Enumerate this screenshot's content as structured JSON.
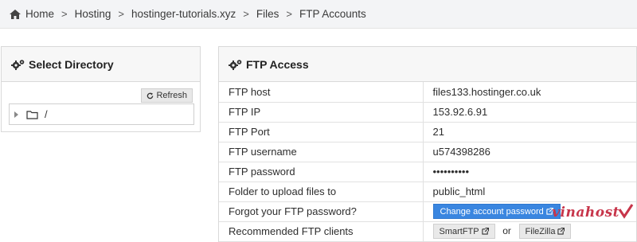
{
  "breadcrumb": {
    "items": [
      {
        "label": "Home",
        "icon": "home-icon"
      },
      {
        "label": "Hosting"
      },
      {
        "label": "hostinger-tutorials.xyz"
      },
      {
        "label": "Files"
      },
      {
        "label": "FTP Accounts"
      }
    ],
    "separator": ">"
  },
  "select_directory": {
    "title": "Select Directory",
    "icon": "cogs-icon",
    "refresh_label": "Refresh",
    "tree_root": "/"
  },
  "ftp_access": {
    "title": "FTP Access",
    "icon": "cogs-icon",
    "rows": [
      {
        "key": "FTP host",
        "value": "files133.hostinger.co.uk"
      },
      {
        "key": "FTP IP",
        "value": "153.92.6.91"
      },
      {
        "key": "FTP Port",
        "value": "21"
      },
      {
        "key": "FTP username",
        "value": "u574398286"
      },
      {
        "key": "FTP password",
        "value": "••••••••••"
      },
      {
        "key": "Folder to upload files to",
        "value": "public_html"
      },
      {
        "key": "Forgot your FTP password?",
        "button": "Change account password"
      },
      {
        "key": "Recommended FTP clients",
        "client_1": "SmartFTP",
        "or": "or",
        "client_2": "FileZilla"
      }
    ]
  },
  "watermark": {
    "text": "vinahost"
  },
  "colors": {
    "accent": "#3a86e0",
    "watermark": "#c7354a"
  }
}
